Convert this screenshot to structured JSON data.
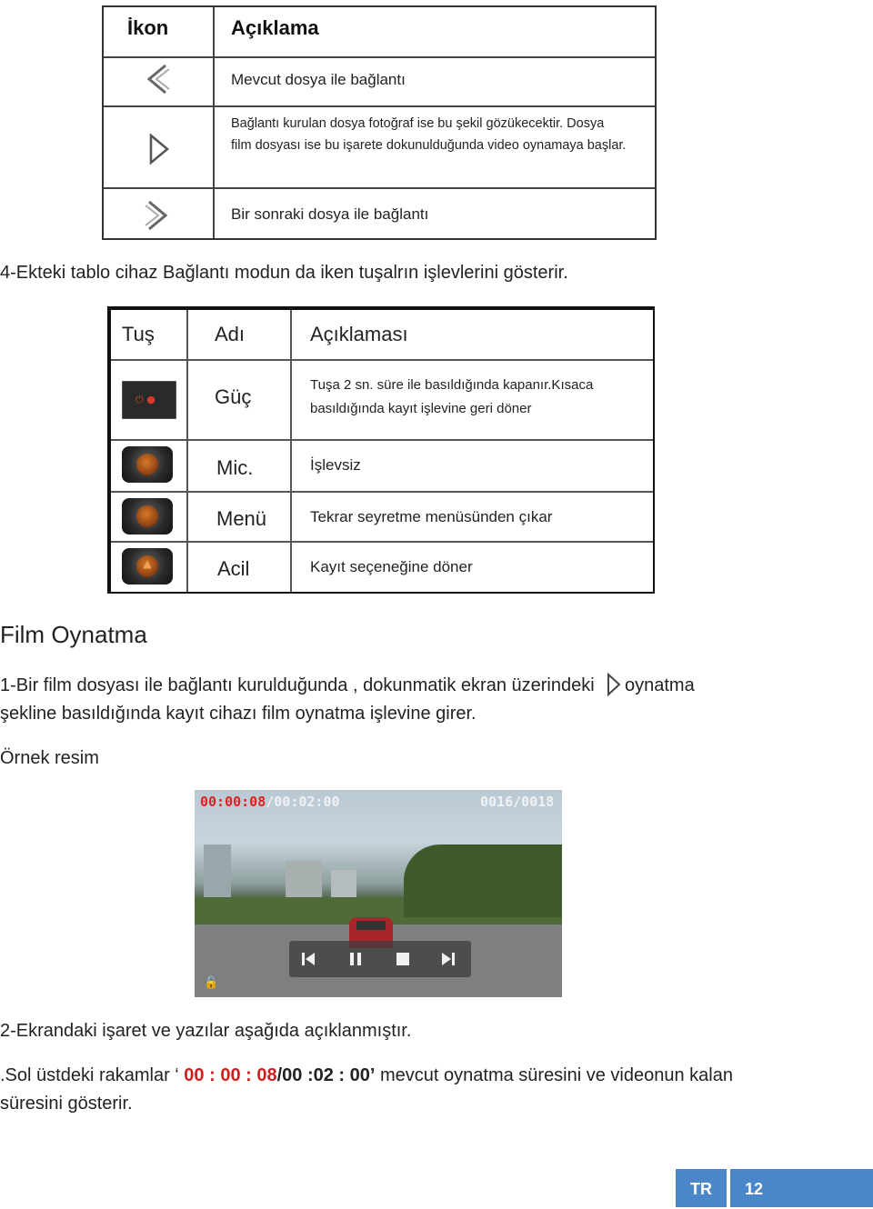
{
  "table1": {
    "header_icon": "İkon",
    "header_desc": "Açıklama",
    "rows": [
      {
        "icon": "previous-chevron-icon",
        "text": "Mevcut dosya ile bağlantı"
      },
      {
        "icon": "play-triangle-icon",
        "text_line1": "Bağlantı kurulan dosya fotoğraf ise bu şekil gözükecektir. Dosya",
        "text_line2": "film dosyası ise bu işarete dokunulduğunda video oynamaya başlar."
      },
      {
        "icon": "next-chevron-icon",
        "text": "Bir sonraki dosya ile bağlantı"
      }
    ]
  },
  "intro_line": "4-Ekteki tablo cihaz Bağlantı modun da iken tuşalrın işlevlerini gösterir.",
  "table2": {
    "headers": {
      "key": "Tuş",
      "name": "Adı",
      "desc": "Açıklaması"
    },
    "rows": [
      {
        "icon": "power-button-icon",
        "name": "Güç",
        "desc_line1": "Tuşa 2 sn. süre ile basıldığında kapanır.Kısaca",
        "desc_line2": "basıldığında kayıt işlevine geri döner"
      },
      {
        "icon": "mic-button-icon",
        "name": "Mic.",
        "desc": "İşlevsiz"
      },
      {
        "icon": "menu-button-icon",
        "name": "Menü",
        "desc": "Tekrar seyretme menüsünden çıkar"
      },
      {
        "icon": "emergency-button-icon",
        "name": "Acil",
        "desc": "Kayıt seçeneğine döner"
      }
    ]
  },
  "section_title": "Film Oynatma",
  "para1_part1": "1-Bir film dosyası ile bağlantı kurulduğunda , dokunmatik ekran üzerindeki",
  "para1_part2": "oynatma",
  "para1_line2": "şekline basıldığında kayıt cihazı film oynatma işlevine girer.",
  "example_label": "Örnek resim",
  "video": {
    "elapsed": "00:00:08",
    "remaining": "/00:02:00",
    "file_counter": "0016/0018"
  },
  "para2": "2-Ekrandaki işaret ve yazılar aşağıda açıklanmıştır.",
  "para3": {
    "prefix": ".Sol üstdeki rakamlar ‘ ",
    "red_part": "00 : 00 : 08",
    "bold_part": "/00 :02 : 00’",
    "suffix": " mevcut oynatma süresini ve videonun kalan",
    "line2": "süresini gösterir."
  },
  "footer": {
    "lang": "TR",
    "page": "12"
  },
  "colors": {
    "accent_blue": "#4a86c8",
    "time_red": "#d0201f"
  }
}
